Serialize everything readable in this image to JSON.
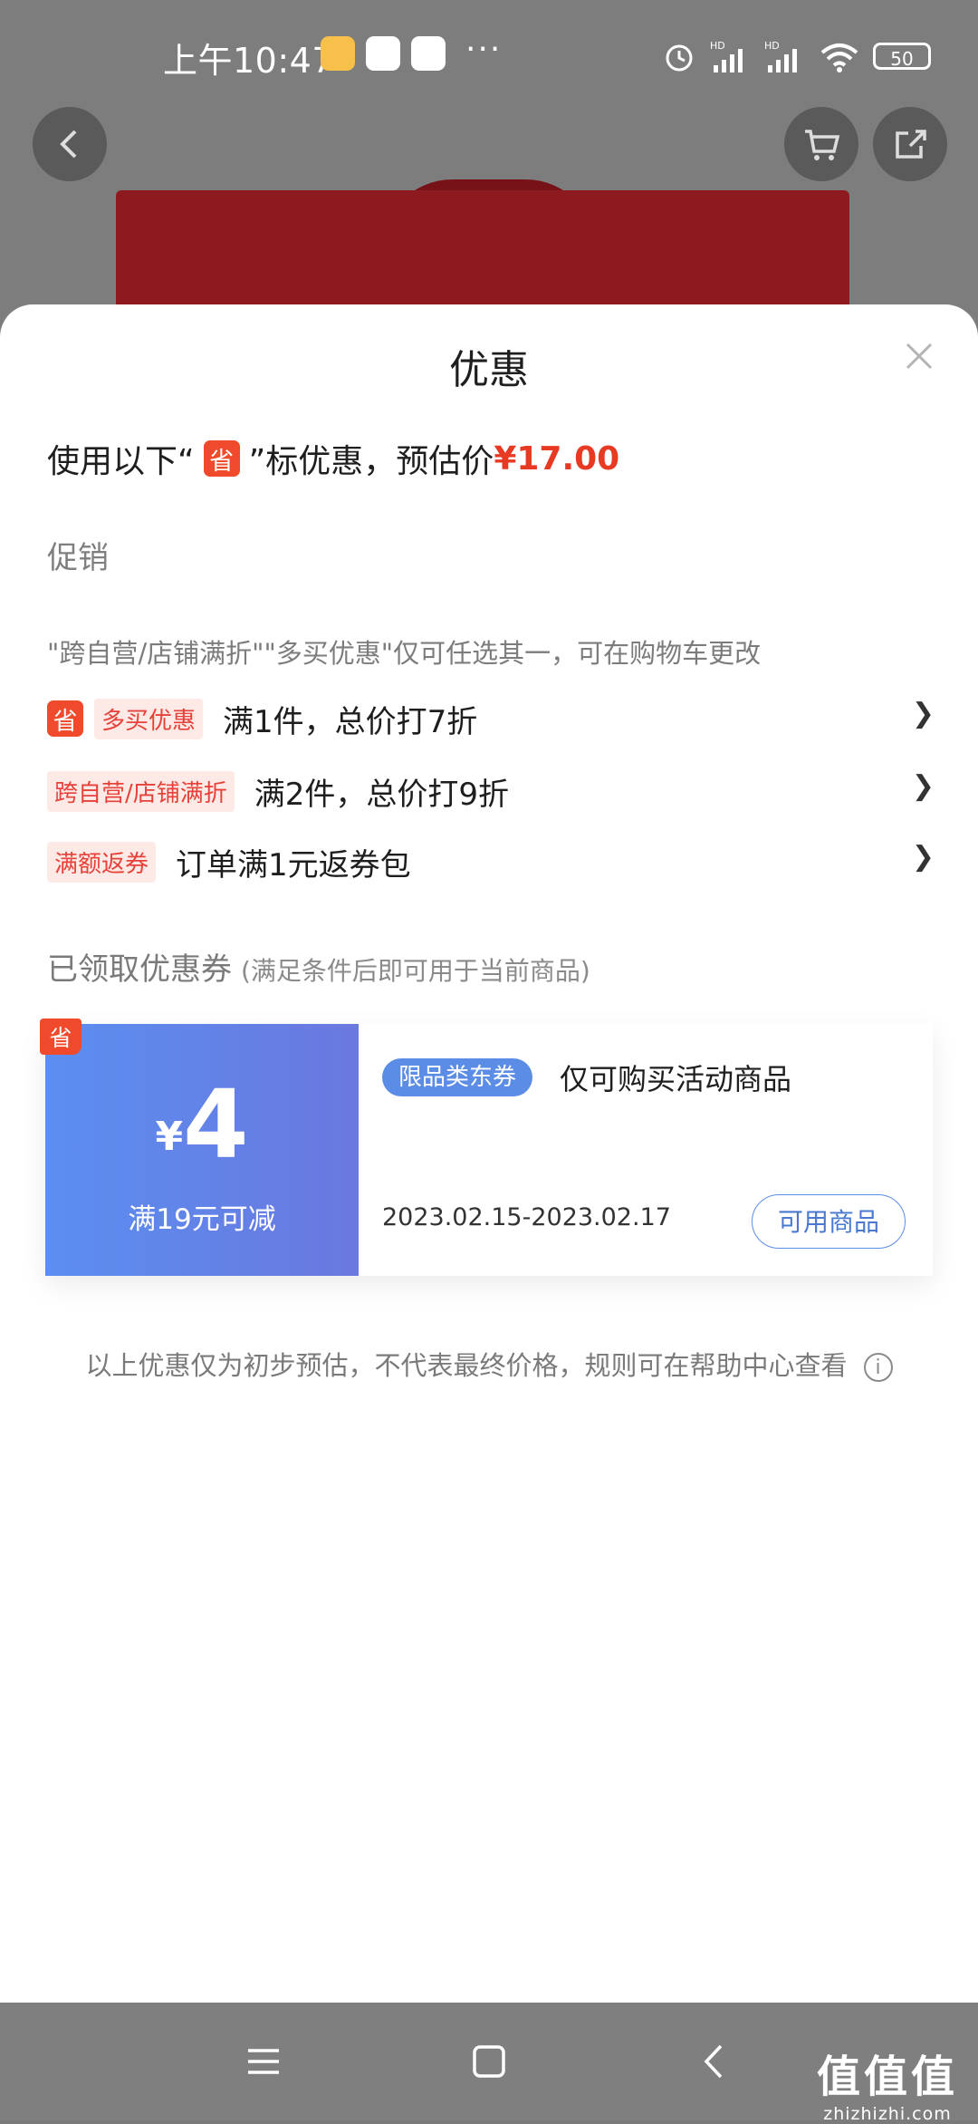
{
  "status_bar": {
    "time": "上午10:47",
    "dots": "···",
    "signal_1": "HD",
    "signal_2": "HD",
    "battery": "50"
  },
  "sheet": {
    "title": "优惠",
    "estimate_prefix": "使用以下“",
    "estimate_badge": "省",
    "estimate_mid": "”标优惠，预估价",
    "estimate_price": "¥17.00"
  },
  "promotion": {
    "section_label": "促销",
    "hint": "\"跨自营/店铺满折\"\"多买优惠\"仅可任选其一，可在购物车更改",
    "rows": [
      {
        "badge": "省",
        "tag": "多买优惠",
        "text": "满1件，总价打7折",
        "chevron": "❯"
      },
      {
        "tag": "跨自营/店铺满折",
        "text": "满2件，总价打9折",
        "chevron": "❯"
      },
      {
        "tag": "满额返券",
        "text": "订单满1元返券包",
        "chevron": "❯"
      }
    ]
  },
  "coupons": {
    "section_label": "已领取优惠券",
    "section_sub": "(满足条件后即可用于当前商品)",
    "items": [
      {
        "badge": "省",
        "currency": "¥",
        "amount": "4",
        "condition": "满19元可减",
        "category_tag": "限品类东券",
        "description": "仅可购买活动商品",
        "validity": "2023.02.15-2023.02.17",
        "button": "可用商品"
      }
    ]
  },
  "disclaimer": "以上优惠仅为初步预估，不代表最终价格，规则可在帮助中心查看",
  "info_icon_glyph": "i",
  "watermark": {
    "big": "值值值",
    "small": "zhizhizhi.com"
  },
  "colors": {
    "accent_red": "#e83a23",
    "coupon_blue": "#5b8ef0",
    "tag_bg": "#fdeae6"
  }
}
